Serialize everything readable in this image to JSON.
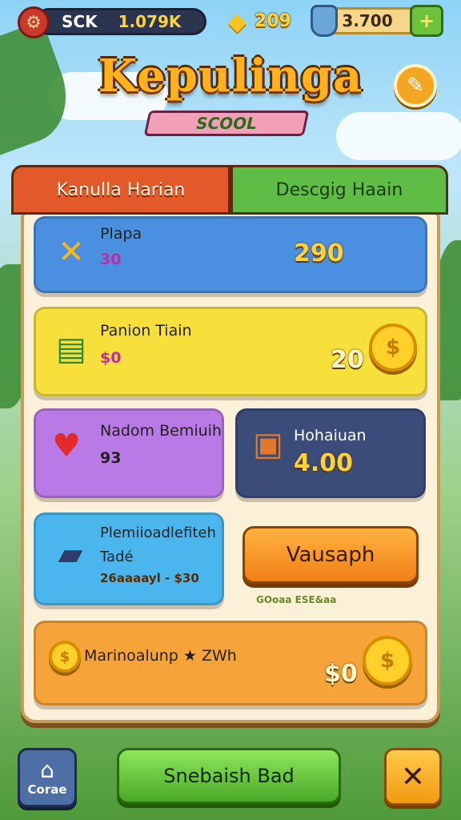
{
  "topbar": {
    "player_tag": "SCK",
    "player_score": "1.079K",
    "gems": "209",
    "coins": "3.700",
    "plus_symbol": "+"
  },
  "title": {
    "main": "Kepulinga",
    "sub": "SCOOL"
  },
  "tabs": [
    {
      "label": "Kanulla Harian"
    },
    {
      "label": "Descgig Haain"
    }
  ],
  "offers": [
    {
      "name": "Plapa",
      "sub": "30",
      "price": "290",
      "color": "#4a8fe0",
      "icon": "sword-cross-icon"
    },
    {
      "name": "Panion Tiain",
      "sub": "$0",
      "price": "20",
      "color": "#f7df3c",
      "icon": "cash-stack-icon"
    },
    {
      "name": "Nadom Bemiuih",
      "sub": "93",
      "color": "#b97ae6",
      "icon": "heart-key-icon"
    },
    {
      "name": "Hohaiuan",
      "price": "4.00",
      "color": "#3b4b7a",
      "icon": "crate-icon"
    },
    {
      "name": "Plemiioadlefiteh",
      "line2": "Tadé",
      "sub": "26aaaayl - $30",
      "color": "#4bb6ee",
      "icon": "book-tool-icon"
    },
    {
      "name": "Marinoalunp ★ ZWh",
      "price": "$0",
      "color": "#f6a43a",
      "icon": "coin-icon"
    }
  ],
  "vausaph_button": "Vausaph",
  "small_note": "GOoaa ESE&aa",
  "bottom": {
    "home_label": "Corae",
    "main_button": "Snebaish Bad"
  },
  "colors": {
    "panel_bg": "#fbf0d8",
    "tab_active": "#e35a2a",
    "tab_inactive": "#5fbd45",
    "gold": "#ffcf2a"
  }
}
